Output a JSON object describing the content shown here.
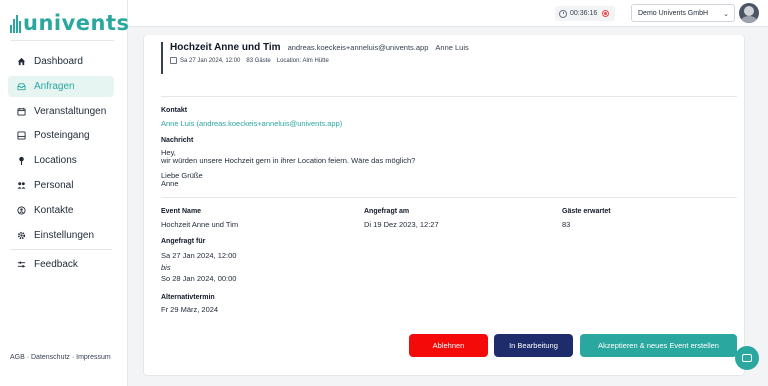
{
  "brand": {
    "logo_text": "univents",
    "accent_color": "#2aa89f"
  },
  "sidebar": {
    "items": [
      {
        "label": "Dashboard",
        "icon": "home-icon",
        "active": false
      },
      {
        "label": "Anfragen",
        "icon": "inbox-icon",
        "active": true
      },
      {
        "label": "Veranstaltungen",
        "icon": "calendar-icon",
        "active": false
      },
      {
        "label": "Posteingang",
        "icon": "mailbox-icon",
        "active": false
      },
      {
        "label": "Locations",
        "icon": "map-pin-icon",
        "active": false
      },
      {
        "label": "Personal",
        "icon": "users-icon",
        "active": false
      },
      {
        "label": "Kontakte",
        "icon": "contacts-icon",
        "active": false
      },
      {
        "label": "Einstellungen",
        "icon": "gear-icon",
        "active": false
      }
    ],
    "feedback_label": "Feedback",
    "footer": "AGB · Datenschutz · Impressum"
  },
  "topbar": {
    "timer": "00:36:16",
    "company": "Demo Univents GmbH"
  },
  "request": {
    "title": "Hochzeit Anne und Tim",
    "email": "andreas.koeckeis+anneluis@univents.app",
    "contact_name": "Anne Luis",
    "date": "Sa 27 Jan 2024, 12:00",
    "guests": "83 Gäste",
    "location": "Location: Alm Hütte"
  },
  "contact": {
    "label": "Kontakt",
    "value": "Anne Luis (andreas.koeckeis+anneluis@univents.app)"
  },
  "message": {
    "label": "Nachricht",
    "line1": "Hey,",
    "line2": "wir würden unsere Hochzeit gern in ihrer Location feiern. Wäre das möglich?",
    "line3": "Liebe Grüße",
    "line4": "Anne"
  },
  "details": {
    "event_name_label": "Event Name",
    "event_name": "Hochzeit Anne und Tim",
    "requested_at_label": "Angefragt am",
    "requested_at": "Di 19 Dez 2023, 12:27",
    "guests_expected_label": "Gäste erwartet",
    "guests_expected": "83",
    "requested_for_label": "Angefragt für",
    "from": "Sa 27 Jan 2024, 12:00",
    "until_word": "bis",
    "to": "So 28 Jan 2024, 00:00",
    "alt_label": "Alternativtermin",
    "alt_date": "Fr 29 März, 2024"
  },
  "actions": {
    "reject": "Ablehnen",
    "in_progress": "In Bearbeitung",
    "accept": "Akzeptieren & neues Event erstellen"
  }
}
